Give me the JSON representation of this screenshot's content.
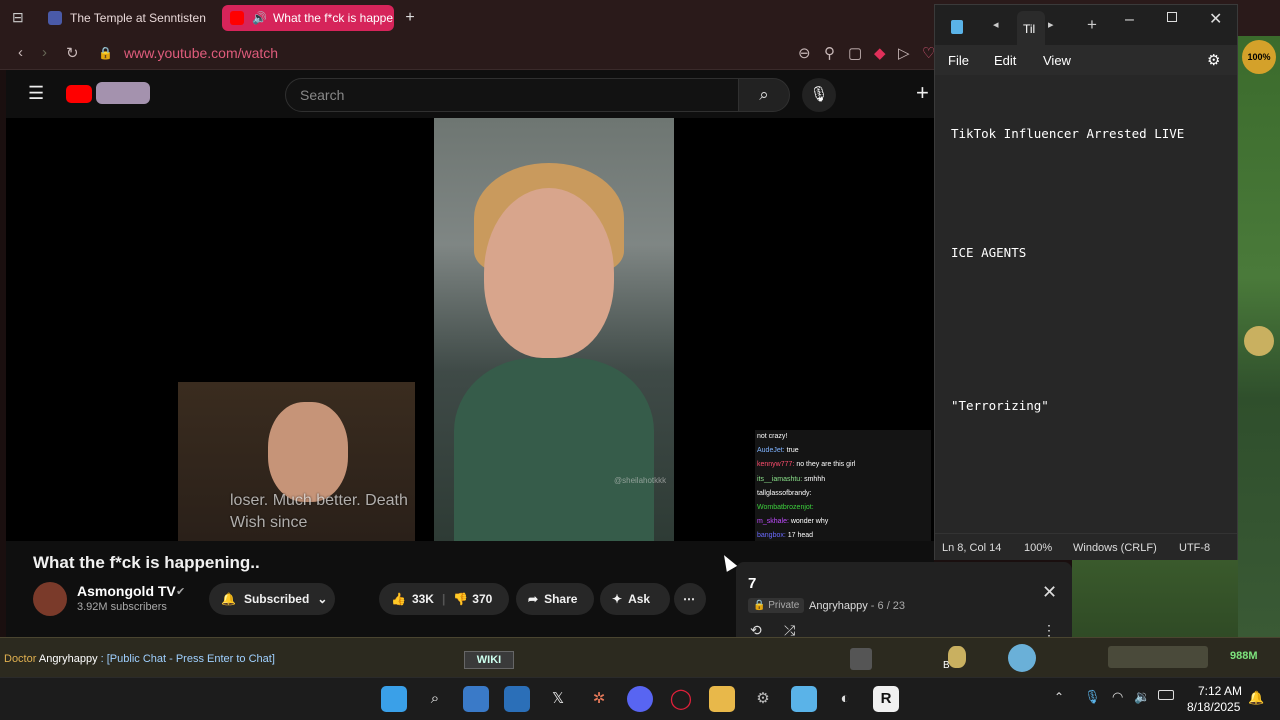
{
  "browser": {
    "tabs": [
      {
        "title": "The Temple at Senntisten"
      },
      {
        "title": "What the f*ck is happe"
      }
    ],
    "url": "www.youtube.com/watch"
  },
  "youtube": {
    "search_placeholder": "Search",
    "video_caption": "loser. Much better. Death Wish since",
    "video_title": "What the f*ck is happening..",
    "channel_name": "Asmongold TV",
    "subscribers": "3.92M subscribers",
    "subscribe_label": "Subscribed",
    "likes": "33K",
    "dislikes": "370",
    "share_label": "Share",
    "ask_label": "Ask",
    "watermark": "@sheilahotkkk",
    "chat": [
      {
        "user": "",
        "msg": "not crazy!",
        "color": "#ffffff"
      },
      {
        "user": "AudeJet:",
        "msg": "true",
        "color": "#7fb3ff"
      },
      {
        "user": "kennyw777:",
        "msg": "no they are this girl",
        "color": "#ff4d6d"
      },
      {
        "user": "its__iamashtu:",
        "msg": "smhhh",
        "color": "#8ae18a"
      },
      {
        "user": "tallglassofbrandy:",
        "msg": "",
        "color": "#ffffff"
      },
      {
        "user": "Wombatbrozenjot:",
        "msg": "",
        "color": "#3dd13d"
      },
      {
        "user": "m_skhale:",
        "msg": "wonder why",
        "color": "#c04bff"
      },
      {
        "user": "bangbox:",
        "msg": "17 head",
        "color": "#6b6bff"
      }
    ],
    "playlist": {
      "title": "7",
      "privacy": "Private",
      "owner": "Angryhappy",
      "position": "6 / 23"
    }
  },
  "notepad": {
    "tab_title": "Til",
    "menu": [
      "File",
      "Edit",
      "View"
    ],
    "lines": [
      "TikTok Influencer Arrested LIVE",
      "",
      "",
      "ICE AGENTS",
      "",
      "",
      "",
      "\"Terrorizing\""
    ],
    "status": {
      "position": "Ln 8, Col 14",
      "zoom": "100%",
      "line_ending": "Windows (CRLF)",
      "encoding": "UTF-8"
    }
  },
  "game": {
    "chat_prefix": "Doctor",
    "chat_name": "Angryhappy",
    "chat_text": ": [Public Chat - Press Enter to Chat]",
    "wiki_label": "WIKI",
    "gold": "988M",
    "zoom_badge": "100%",
    "slot_letter": "B"
  },
  "taskbar": {
    "time": "7:12 AM",
    "date": "8/18/2025"
  }
}
